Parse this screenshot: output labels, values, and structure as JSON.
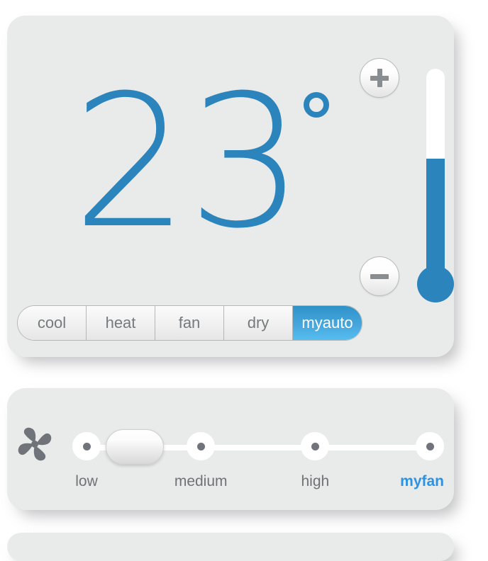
{
  "theme": {
    "page_background": "#ffffff",
    "card_background": "#e9ebeb",
    "accent_blue": "#2b84bb",
    "accent_blue_light": "#2b92e4",
    "text_gray": "#6f7376",
    "icon_gray": "#70747a"
  },
  "temperature_panel": {
    "name": "temperature-card",
    "value": "23",
    "degree_symbol": "°",
    "unit_display": "degrees",
    "increase_button": {
      "label": "+",
      "icon": "plus-icon"
    },
    "decrease_button": {
      "label": "−",
      "icon": "minus-icon"
    },
    "thermometer": {
      "icon": "thermometer-icon",
      "fill_percent": 59,
      "fill_color": "#2b84bb",
      "tube_color": "#ffffff"
    },
    "modes": [
      {
        "label": "cool",
        "selected": false
      },
      {
        "label": "heat",
        "selected": false
      },
      {
        "label": "fan",
        "selected": false
      },
      {
        "label": "dry",
        "selected": false
      },
      {
        "label": "myauto",
        "selected": true
      }
    ]
  },
  "fan_panel": {
    "name": "fan-speed-card",
    "icon": "fan-blades-icon",
    "handle_position_percent": 14,
    "stops": [
      {
        "label": "low",
        "position_percent": 0,
        "accent": false
      },
      {
        "label": "medium",
        "position_percent": 33.3,
        "accent": false
      },
      {
        "label": "high",
        "position_percent": 66.6,
        "accent": false
      },
      {
        "label": "myfan",
        "position_percent": 100,
        "accent": true
      }
    ]
  }
}
